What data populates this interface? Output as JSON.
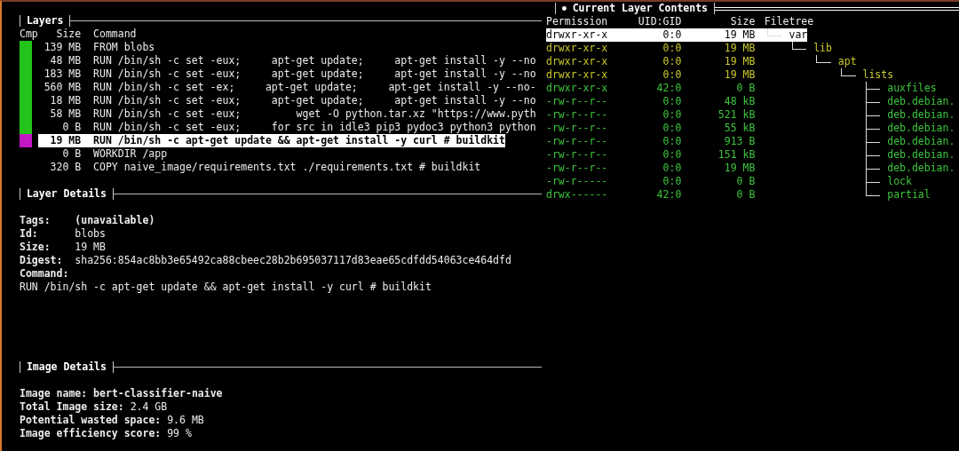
{
  "layers": {
    "title": "Layers",
    "columns": [
      "Cmp",
      "Size",
      "Command"
    ],
    "rows": [
      {
        "color": "#22c41a",
        "size": "139 MB",
        "command": "FROM blobs",
        "selected": false
      },
      {
        "color": "#22c41a",
        "size": "48 MB",
        "command": "RUN /bin/sh -c set -eux;     apt-get update;     apt-get install -y --no",
        "selected": false
      },
      {
        "color": "#22c41a",
        "size": "183 MB",
        "command": "RUN /bin/sh -c set -eux;     apt-get update;     apt-get install -y --no",
        "selected": false
      },
      {
        "color": "#22c41a",
        "size": "560 MB",
        "command": "RUN /bin/sh -c set -ex;     apt-get update;     apt-get install -y --no-",
        "selected": false
      },
      {
        "color": "#22c41a",
        "size": "18 MB",
        "command": "RUN /bin/sh -c set -eux;     apt-get update;     apt-get install -y --no",
        "selected": false
      },
      {
        "color": "#22c41a",
        "size": "58 MB",
        "command": "RUN /bin/sh -c set -eux;         wget -O python.tar.xz \"https://www.pyth",
        "selected": false
      },
      {
        "color": "#22c41a",
        "size": "0 B",
        "command": "RUN /bin/sh -c set -eux;     for src in idle3 pip3 pydoc3 python3 python",
        "selected": false
      },
      {
        "color": "#c416c4",
        "size": "19 MB",
        "command": "RUN /bin/sh -c apt-get update && apt-get install -y curl # buildkit",
        "selected": true
      },
      {
        "size": "0 B",
        "command": "WORKDIR /app",
        "selected": false
      },
      {
        "size": "320 B",
        "command": "COPY naive_image/requirements.txt ./requirements.txt # buildkit",
        "selected": false
      }
    ]
  },
  "layer_details": {
    "title": "Layer Details",
    "fields": [
      {
        "label": "Tags:",
        "value": "(unavailable)",
        "value_bold": true
      },
      {
        "label": "Id:",
        "value": "blobs",
        "value_bold": false
      },
      {
        "label": "Size:",
        "value": "19 MB",
        "value_bold": false
      },
      {
        "label": "Digest:",
        "value": "sha256:854ac8bb3e65492ca88cbeec28b2b695037117d83eae65cdfdd54063ce464dfd",
        "value_bold": false
      }
    ],
    "command_label": "Command:",
    "command": "RUN /bin/sh -c apt-get update && apt-get install -y curl # buildkit"
  },
  "image_details": {
    "title": "Image Details",
    "fields": [
      {
        "label": "Image name:",
        "value": "bert-classifier-naive",
        "value_bold": true
      },
      {
        "label": "Total Image size:",
        "value": "2.4 GB",
        "value_bold": false
      },
      {
        "label": "Potential wasted space:",
        "value": "9.6 MB",
        "value_bold": false
      },
      {
        "label": "Image efficiency score:",
        "value": "99 %",
        "value_bold": false
      }
    ]
  },
  "layer_contents": {
    "title": "Current Layer Contents",
    "focused": true,
    "columns": [
      "Permission",
      "UID:GID",
      "Size",
      "Filetree"
    ],
    "tree": [
      {
        "name": "var",
        "permission": "drwxr-xr-x",
        "uid_gid": "0:0",
        "size": "19 MB",
        "selected": true,
        "children": [
          {
            "name": "lib",
            "permission": "drwxr-xr-x",
            "uid_gid": "0:0",
            "size": "19 MB",
            "color": "#c8c82a",
            "selected": false,
            "children": [
              {
                "name": "apt",
                "permission": "drwxr-xr-x",
                "uid_gid": "0:0",
                "size": "19 MB",
                "color": "#c8c82a",
                "selected": false,
                "children": [
                  {
                    "name": "lists",
                    "permission": "drwxr-xr-x",
                    "uid_gid": "0:0",
                    "size": "19 MB",
                    "color": "#c8c82a",
                    "selected": false,
                    "children": [
                      {
                        "name": "auxfiles",
                        "permission": "drwxr-xr-x",
                        "uid_gid": "42:0",
                        "size": "0 B",
                        "color": "#3cc43c",
                        "selected": false
                      },
                      {
                        "name": "deb.debian.",
                        "permission": "-rw-r--r--",
                        "uid_gid": "0:0",
                        "size": "48 kB",
                        "color": "#3cc43c",
                        "selected": false
                      },
                      {
                        "name": "deb.debian.",
                        "permission": "-rw-r--r--",
                        "uid_gid": "0:0",
                        "size": "521 kB",
                        "color": "#3cc43c",
                        "selected": false
                      },
                      {
                        "name": "deb.debian.",
                        "permission": "-rw-r--r--",
                        "uid_gid": "0:0",
                        "size": "55 kB",
                        "color": "#3cc43c",
                        "selected": false
                      },
                      {
                        "name": "deb.debian.",
                        "permission": "-rw-r--r--",
                        "uid_gid": "0:0",
                        "size": "913 B",
                        "color": "#3cc43c",
                        "selected": false
                      },
                      {
                        "name": "deb.debian.",
                        "permission": "-rw-r--r--",
                        "uid_gid": "0:0",
                        "size": "151 kB",
                        "color": "#3cc43c",
                        "selected": false
                      },
                      {
                        "name": "deb.debian.",
                        "permission": "-rw-r--r--",
                        "uid_gid": "0:0",
                        "size": "19 MB",
                        "color": "#3cc43c",
                        "selected": false
                      },
                      {
                        "name": "lock",
                        "permission": "-rw-r-----",
                        "uid_gid": "0:0",
                        "size": "0 B",
                        "color": "#3cc43c",
                        "selected": false
                      },
                      {
                        "name": "partial",
                        "permission": "drwx------",
                        "uid_gid": "42:0",
                        "size": "0 B",
                        "color": "#3cc43c",
                        "selected": false
                      }
                    ]
                  }
                ]
              }
            ]
          }
        ]
      }
    ]
  }
}
